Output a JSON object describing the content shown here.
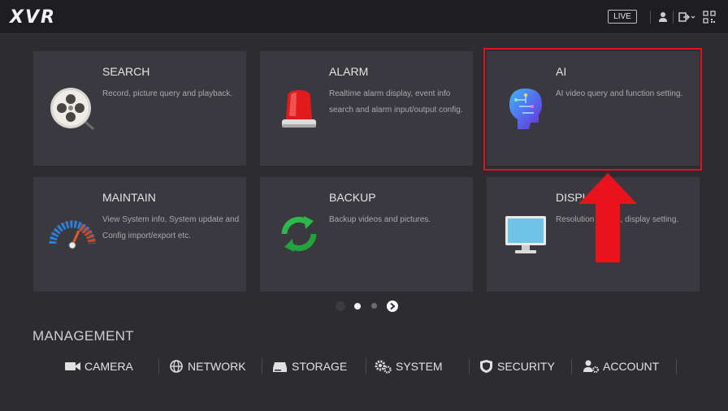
{
  "app": {
    "logo": "XVR",
    "live_label": "LIVE"
  },
  "tiles": [
    {
      "title": "SEARCH",
      "desc": "Record, picture query and playback.",
      "icon": "film-reel-search-icon"
    },
    {
      "title": "ALARM",
      "desc": "Realtime alarm display, event info search and alarm input/output config.",
      "icon": "siren-icon"
    },
    {
      "title": "AI",
      "desc": "AI video query and function setting.",
      "icon": "ai-head-icon"
    },
    {
      "title": "MAINTAIN",
      "desc": "View System info, System update and Config import/export etc.",
      "icon": "gauge-icon"
    },
    {
      "title": "BACKUP",
      "desc": "Backup videos and pictures.",
      "icon": "sync-arrows-icon"
    },
    {
      "title": "DISPLAY",
      "desc": "Resolution setting, display setting.",
      "icon": "monitor-icon"
    }
  ],
  "pager": {
    "pages": 3,
    "current": 1
  },
  "management": {
    "title": "MANAGEMENT",
    "items": [
      {
        "label": "CAMERA",
        "icon": "camera-icon"
      },
      {
        "label": "NETWORK",
        "icon": "network-globe-icon"
      },
      {
        "label": "STORAGE",
        "icon": "storage-drive-icon"
      },
      {
        "label": "SYSTEM",
        "icon": "gears-icon"
      },
      {
        "label": "SECURITY",
        "icon": "shield-icon"
      },
      {
        "label": "ACCOUNT",
        "icon": "user-gear-icon"
      }
    ]
  },
  "annotation": {
    "highlight_color": "#e0131d",
    "highlight_target": "AI"
  }
}
